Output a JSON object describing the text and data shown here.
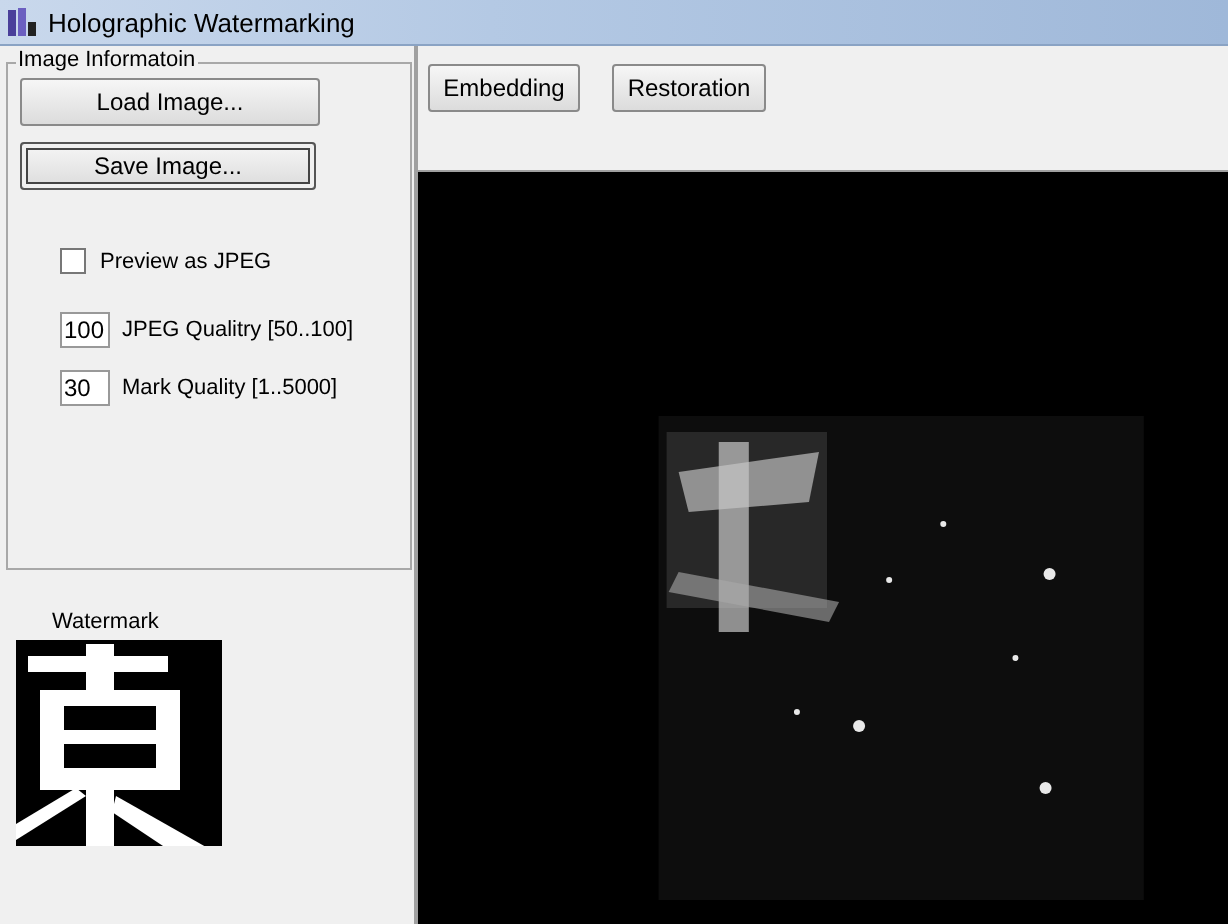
{
  "window": {
    "title": "Holographic Watermarking"
  },
  "image_information": {
    "title": "Image Informatoin",
    "buttons": [
      {
        "label": "Load Image...",
        "focused": false
      },
      {
        "label": "Save Image...",
        "focused": true
      }
    ],
    "preview_as_jpeg": {
      "label": "Preview as JPEG",
      "checked": false
    },
    "fields": [
      {
        "value": "100",
        "label": "JPEG Qualitry [50..100]"
      },
      {
        "value": "30",
        "label": "Mark Quality [1..5000]"
      }
    ]
  },
  "watermark": {
    "label": "Watermark",
    "kind": "picture"
  },
  "toolbar": {
    "buttons": [
      "Embedding",
      "Restoration"
    ]
  }
}
